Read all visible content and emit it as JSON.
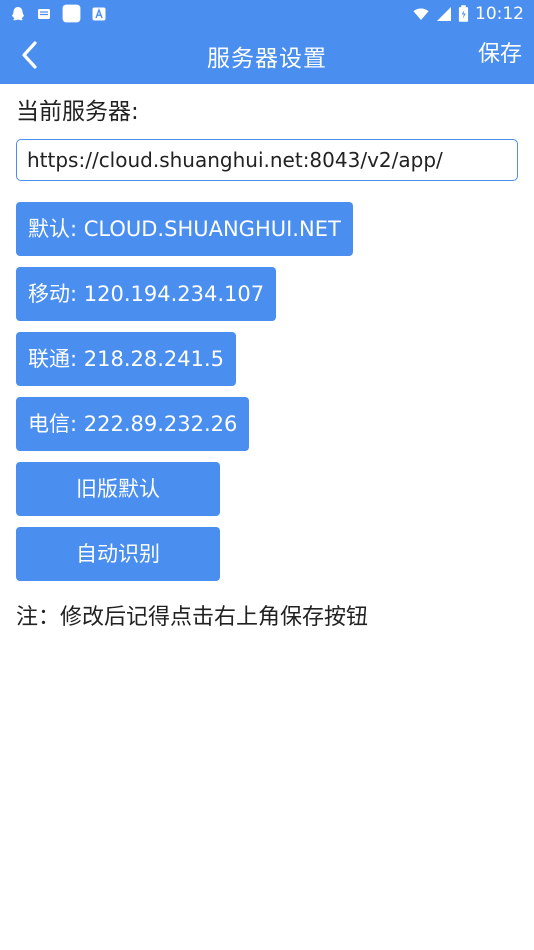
{
  "status_bar": {
    "time": "10:12",
    "left_icons": [
      "qq-icon",
      "mail-icon",
      "notification-square-icon",
      "app-a-icon"
    ],
    "right_icons": [
      "wifi-icon",
      "signal-icon",
      "battery-icon"
    ]
  },
  "app_bar": {
    "title": "服务器设置",
    "save_label": "保存",
    "back_icon": "chevron-left-icon",
    "color": "#4a8ef0"
  },
  "current_server": {
    "label": "当前服务器:",
    "value": "https://cloud.shuanghui.net:8043/v2/app/"
  },
  "server_buttons": [
    {
      "label": "默认: CLOUD.SHUANGHUI.NET"
    },
    {
      "label": "移动: 120.194.234.107"
    },
    {
      "label": "联通: 218.28.241.5"
    },
    {
      "label": "电信: 222.89.232.26"
    },
    {
      "label": "旧版默认"
    },
    {
      "label": "自动识别"
    }
  ],
  "note": "注：修改后记得点击右上角保存按钮"
}
